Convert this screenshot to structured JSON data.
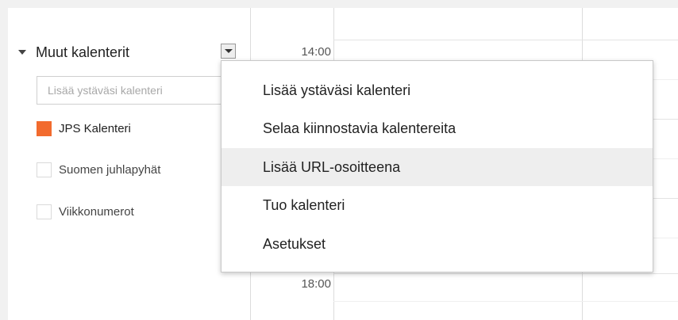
{
  "sidebar": {
    "section_title": "Muut kalenterit",
    "add_friend_placeholder": "Lisää ystäväsi kalenteri",
    "calendars": [
      {
        "label": "JPS Kalenteri",
        "checked": true,
        "color": "#f26b2e"
      },
      {
        "label": "Suomen juhlapyhät",
        "checked": false,
        "color": "#ffffff"
      },
      {
        "label": "Viikkonumerot",
        "checked": false,
        "color": "#ffffff"
      }
    ]
  },
  "timegrid": {
    "times": [
      "14:00",
      "18:00"
    ]
  },
  "menu": {
    "items": [
      {
        "label": "Lisää ystäväsi kalenteri"
      },
      {
        "label": "Selaa kiinnostavia kalentereita"
      },
      {
        "label": "Lisää URL-osoitteena",
        "highlighted": true
      },
      {
        "label": "Tuo kalenteri"
      },
      {
        "label": "Asetukset"
      }
    ],
    "highlight_color": "#eeeeee"
  }
}
